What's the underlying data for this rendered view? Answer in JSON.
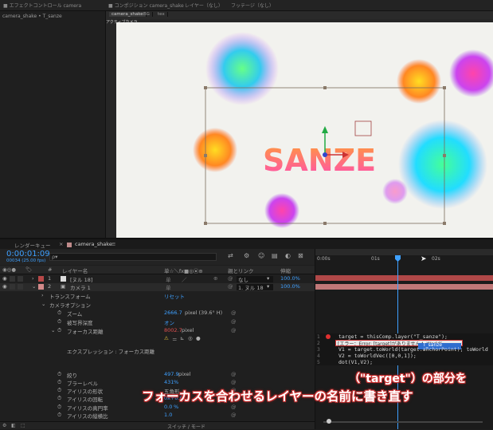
{
  "top": {
    "left_title": "■ エフェクトコントロール camera",
    "mid_title": "■ コンポジション camera_shake",
    "right_title": "レイヤー（なし）",
    "far_right": "フッテージ（なし）"
  },
  "left_panel": {
    "header": "camera_shake • T_sanze"
  },
  "viewer": {
    "tabs": [
      "camera_shake",
      "BG",
      "tex"
    ],
    "active_tab": "camera_shake",
    "sub_label": "アクティブカメラ",
    "canvas_text": "SANZE"
  },
  "timeline": {
    "tabs": [
      "レンダーキュー",
      "camera_shake"
    ],
    "timecode": "0:00:01:09",
    "frame_info": "00034 (25.00 fps)",
    "search_placeholder": "ρ▾",
    "headers": {
      "num": "#",
      "layer_name": "レイヤー名",
      "switches": "单☆＼fx■◎⦿⊕",
      "parent": "親とリンク",
      "stretch": "伸縮"
    },
    "ruler": [
      "0:00s",
      "01s",
      "02s"
    ],
    "layers": [
      {
        "num": "1",
        "name": "[ヌル 18]",
        "parent": "なし",
        "stretch": "100.0%"
      },
      {
        "num": "2",
        "name": "カメラ 1",
        "parent": "1. ヌル 18",
        "stretch": "100.0%"
      }
    ],
    "props": {
      "transform": "トランスフォーム",
      "transform_reset": "リセット",
      "camera_options": "カメラオプション",
      "zoom": "ズーム",
      "zoom_value": "2666.7",
      "zoom_unit": "pixel (39.6° H)",
      "dof": "被写界深度",
      "dof_value": "オン",
      "focus": "フォーカス距離",
      "focus_value": "8002.7",
      "focus_unit": "pixel",
      "expression_label": "エクスプレッション : フォーカス距離",
      "aperture": "絞り",
      "aperture_value": "497.9",
      "aperture_unit": "pixel",
      "blur": "ブラーレベル",
      "blur_value": "431",
      "blur_unit": "%",
      "iris_shape": "アイリスの形状",
      "iris_shape_value": "五角形",
      "iris_rot": "アイリスの回転",
      "iris_rot_value": "0x+0.0°",
      "iris_round": "アイリスの真円率",
      "iris_round_value": "0.0",
      "iris_round_unit": "%",
      "iris_aspect": "アイリスの縦横比",
      "iris_aspect_value": "1.0"
    },
    "bottom_toggle": "スイッチ / モード"
  },
  "expression": {
    "lines": [
      {
        "n": "1",
        "code": "target = thisComp.layer(\"T_sanze\");"
      },
      {
        "n": "2",
        "code": "[エラー：Error: [target]がありません  toWorld("
      },
      {
        "n": "3",
        "code": "V1 = target.toWorld(target.anchorPoint);  toWorld"
      },
      {
        "n": "4",
        "code": "V2 = toWorldVec([0,0,1]);"
      },
      {
        "n": "5",
        "code": "dot(V1,V2);"
      }
    ],
    "autocomplete": "T_sanze"
  },
  "captions": {
    "line1": "（\"target\"）の部分を",
    "line2": "フォーカスを合わせるレイヤーの名前に書き直す"
  },
  "colors": {
    "accent_blue": "#3ea0ff",
    "error_red": "#e05050",
    "layer1_label": "#b84848",
    "layer2_label": "#d38a8a"
  }
}
